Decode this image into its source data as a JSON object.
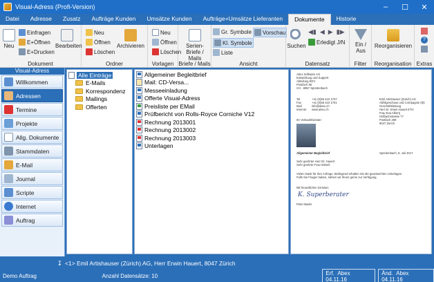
{
  "window": {
    "title": "Visual-Adress (Profi-Version)"
  },
  "menu": [
    "Datei",
    "Adresse",
    "Zusatz",
    "Aufträge Kunden",
    "Umsätze Kunden",
    "Aufträge+Umsätze Lieferanten",
    "Dokumente",
    "Historie"
  ],
  "ribbon": {
    "dokument": {
      "label": "Dokument",
      "neu": "Neu",
      "einfragen": "Einfragen",
      "e_offnen": "E+Öffnen",
      "e_drucken": "E+Drucken",
      "bearbeiten": "Bearbeiten"
    },
    "ordner": {
      "label": "Ordner",
      "neu": "Neu",
      "offnen": "Öffnen",
      "loschen": "Löschen",
      "archivieren": "Archivieren"
    },
    "vorlagen": {
      "label": "Vorlagen",
      "neu": "Neu",
      "offnen": "Öffnen",
      "loschen": "Löschen"
    },
    "briefe": {
      "label": "Briefe / Mails",
      "serien_line1": "Serien-",
      "serien_line2": "Briefe / Mails"
    },
    "ansicht": {
      "label": "Ansicht",
      "gr_symbole": "Gr. Symbole",
      "vorschau": "Vorschau",
      "kl_symbole": "Kl. Symbole",
      "liste": "Liste"
    },
    "datensatz": {
      "label": "Datensatz",
      "suchen": "Suchen",
      "erledigt": "Erledigt J/N"
    },
    "filter": {
      "label": "Filter",
      "ein_aus": "Ein / Aus"
    },
    "reorganisation": {
      "label": "Reorganisation",
      "reorganisieren": "Reorganisieren"
    },
    "extras": {
      "label": "Extras"
    }
  },
  "sidebar": {
    "title": "Visual-Adress",
    "items": [
      "Willkommen",
      "Adressen",
      "Termine",
      "Projekte",
      "Allg. Dokumente",
      "Stammdaten",
      "E-Mail",
      "Journal",
      "Scripte",
      "Internet",
      "Auftrag"
    ],
    "active_index": 1
  },
  "tree": {
    "root": "Alle Einträge",
    "folders": [
      "E-Mails",
      "Korrespondenz",
      "Mailings",
      "Offerten"
    ]
  },
  "documents": [
    {
      "name": "Allgemeiner Begleitbrief",
      "icon": "word"
    },
    {
      "name": "Mail: CD-Versa...",
      "icon": "mail"
    },
    {
      "name": "Messeeinladung",
      "icon": "word"
    },
    {
      "name": "Offerte Visual-Adress",
      "icon": "word"
    },
    {
      "name": "Preisliste per EMail",
      "icon": "excel"
    },
    {
      "name": "Prüfbericht von Rolls-Royce Corniche V12",
      "icon": "word"
    },
    {
      "name": "Rechnung 2013001",
      "icon": "pdf"
    },
    {
      "name": "Rechnung 2013002",
      "icon": "pdf"
    },
    {
      "name": "Rechnung 2013003",
      "icon": "pdf"
    },
    {
      "name": "Unterlagen",
      "icon": "word"
    }
  ],
  "preview": {
    "sender": [
      "Abex Software AG",
      "Entwicklung und Support",
      "Abteilung EDV",
      "Postfach 96",
      "CH - 8957 Spreitenbach"
    ],
    "contact_labels": [
      "Tel",
      "Fax",
      "Mail",
      "Internet"
    ],
    "contact_values": [
      "+41 (0)56 410 1707",
      "+41 (0)56 410 1701",
      "info@abex.ch",
      "www.abex.ch"
    ],
    "recipient": [
      "Emil Artishauser (Zürich) AG",
      "Abhilgeschaus und Cornpagnie (ttt)",
      "Geschäftsleitung",
      "Herr Dr. Erwin Hauert ETH",
      "Frau Eva Albertj",
      "Hofbachstrasse 77",
      "Postfach 299",
      "8047 Zürich"
    ],
    "vertrieb": "Ihr Verkaufsberater:",
    "subject": "Allgemeiner Begleitbrief",
    "date": "Spreitenbach, 9. Juli 2017",
    "salutation": [
      "Sehr geehrter Herr Dr. Hauert",
      "Sehr geehrte Frau Hüberli"
    ],
    "body": [
      "Vielen Dank für Ihre Anfrage. Beiliegend erhalten Sie die gewünschten Unterlagen.",
      "Falls Sie Fragen haben, stehen wir Ihnen gerne zur Verfügung."
    ],
    "closing": "Mit freundlichen Grüssen",
    "signature": "K. Superberater",
    "signer": "Peter Bader"
  },
  "status": {
    "record": "<1> Emil Artishauser (Zürich) AG, Herr Erwin Hauert, 8047 Zürich",
    "mode": "Demo Auftrag",
    "count": "Anzahl Datensätze: 10",
    "created_label": "Erf.",
    "created_value": "Abex 04.11.16",
    "changed_label": "Änd.",
    "changed_value": "Abex 04.11.16"
  }
}
